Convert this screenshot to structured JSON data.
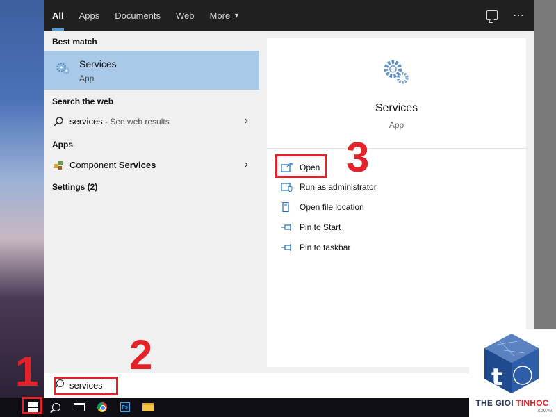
{
  "tabs": {
    "items": [
      "All",
      "Apps",
      "Documents",
      "Web",
      "More"
    ],
    "active": "All"
  },
  "results": {
    "best_match_heading": "Best match",
    "best_match_title": "Services",
    "best_match_subtitle": "App",
    "web_heading": "Search the web",
    "web_query": "services",
    "web_suffix": " - See web results",
    "apps_heading": "Apps",
    "component_prefix": "Component ",
    "component_bold": "Services",
    "settings_heading": "Settings (2)"
  },
  "detail": {
    "title": "Services",
    "subtitle": "App",
    "actions": [
      "Open",
      "Run as administrator",
      "Open file location",
      "Pin to Start",
      "Pin to taskbar"
    ]
  },
  "search": {
    "value": "services"
  },
  "annotations": {
    "step1": "1",
    "step2": "2",
    "step3": "3"
  },
  "watermark": {
    "brand_left": "THE GIOI ",
    "brand_right": "TINHOC",
    "domain": ".COM.VN",
    "cube_letter": "t"
  },
  "colors": {
    "accent": "#4a9be8",
    "highlight_row": "#a9c9e8",
    "annotation_red": "#e3222a",
    "tabs_bg": "#202020",
    "taskbar_bg": "#0e0e14"
  },
  "icons": {
    "feedback": "feedback-icon",
    "more_options": "more-options-icon",
    "services_app": "gear-icon",
    "web_search": "search-icon",
    "component_services": "component-services-icon",
    "chevron": "chevron-right-icon"
  }
}
